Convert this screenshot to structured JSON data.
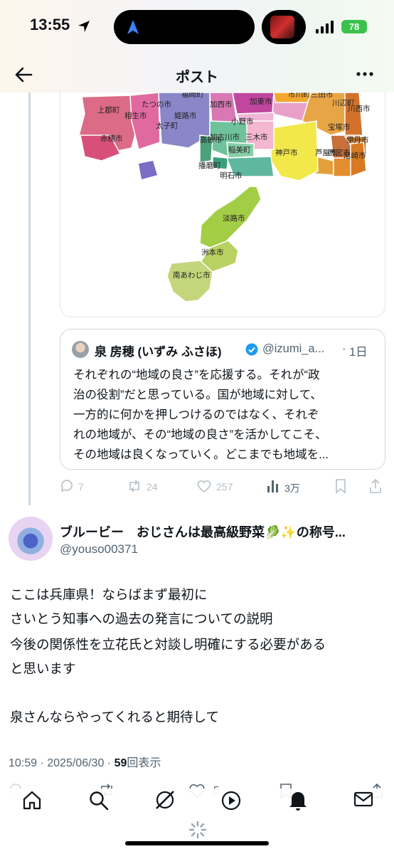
{
  "status_bar": {
    "time": "13:55",
    "battery": "78"
  },
  "header": {
    "title": "ポスト"
  },
  "map": {
    "labels": [
      "福崎町",
      "市川町",
      "加西市",
      "加東市",
      "三田市",
      "川西市",
      "上郡町",
      "たつの市",
      "相生市",
      "姫路市",
      "太子町",
      "小野市",
      "川辺町",
      "宝塚市",
      "伊丹市",
      "赤穂市",
      "加古川市",
      "三木市",
      "神戸市",
      "芦屋市",
      "西宮市",
      "尼崎市",
      "高砂市",
      "稲美町",
      "播磨町",
      "明石市",
      "淡路市",
      "洲本市",
      "南あわじ市"
    ]
  },
  "quote": {
    "name": "泉 房穂 (いずみ ふさほ)",
    "handle": "@izumi_a...",
    "time": "1日",
    "lines": [
      "それぞれの“地域の良さ”を応援する。それが“政",
      "治の役割”だと思っている。国が地域に対して、",
      "一方的に何かを押しつけるのではなく、それぞ",
      "れの地域が、その“地域の良さ”を活かしてこそ、",
      "その地域は良くなっていく。どこまでも地域を..."
    ]
  },
  "actions": {
    "replies": "7",
    "reposts": "24",
    "likes": "257",
    "views": "3万"
  },
  "post": {
    "name": "ブルービー　おじさんは最高級野菜🥬✨の称号...",
    "handle": "@youso00371",
    "lines": [
      "ここは兵庫県！ならばまず最初に",
      "さいとう知事への過去の発言についての説明",
      "今後の関係性を立花氏と対談し明確にする必要がある",
      "と思います",
      "",
      "泉さんならやってくれると期待して"
    ],
    "meta_time": "10:59 · 2025/06/30 · ",
    "meta_views": "59",
    "meta_views_label": "回表示",
    "like_count": "5"
  }
}
